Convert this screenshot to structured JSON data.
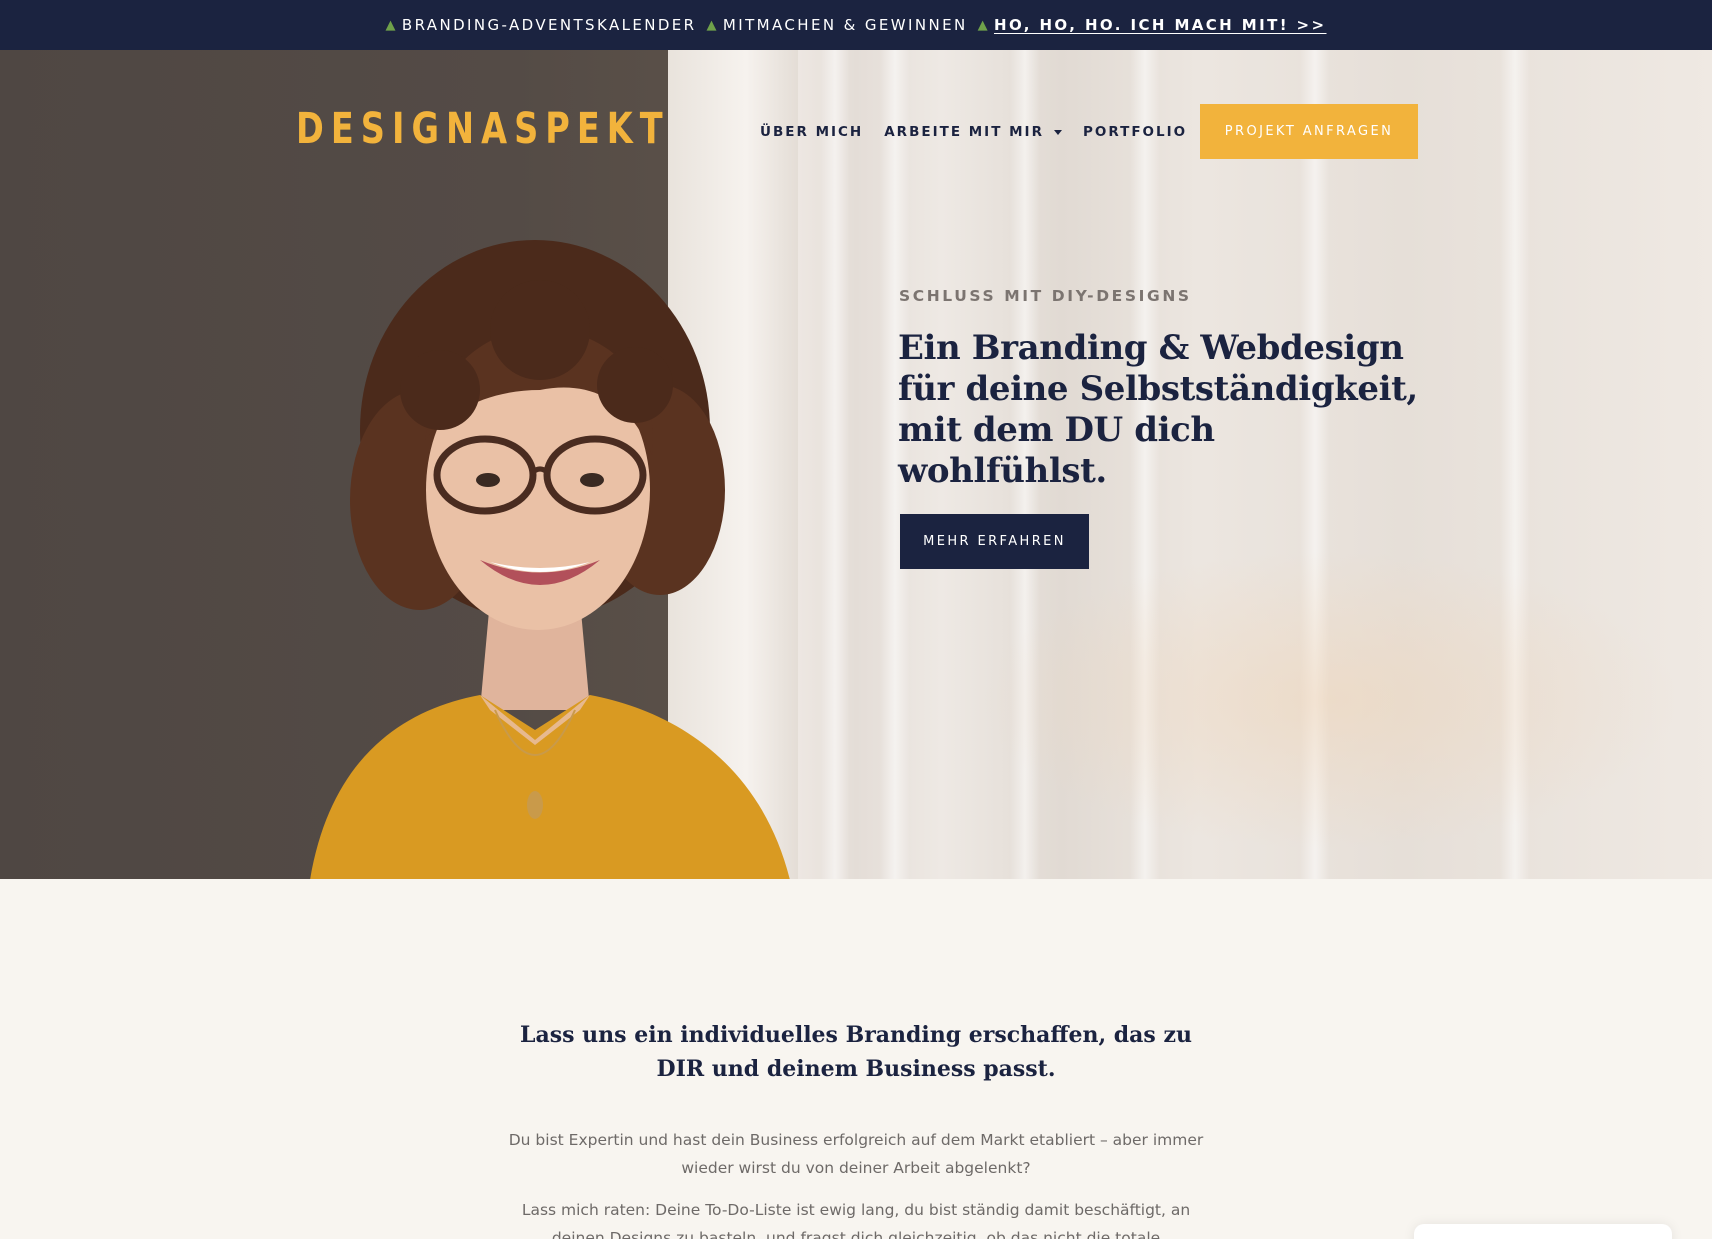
{
  "announcement": {
    "segment1": "BRANDING-ADVENTSKALENDER",
    "segment2": "MITMACHEN & GEWINNEN",
    "link_label": "HO, HO, HO. ICH MACH MIT! >>",
    "tree_icon": "tree-icon"
  },
  "header": {
    "logo": "DESIGNASPEKT",
    "nav": [
      {
        "label": "ÜBER MICH",
        "has_dropdown": false
      },
      {
        "label": "ARBEITE MIT MIR",
        "has_dropdown": true
      },
      {
        "label": "PORTFOLIO",
        "has_dropdown": false
      }
    ],
    "cta_label": "PROJEKT ANFRAGEN"
  },
  "hero": {
    "eyebrow": "SCHLUSS MIT DIY-DESIGNS",
    "headline": "Ein Branding & Webdesign für deine Selbstständigkeit, mit dem DU dich wohlfühlst.",
    "button_label": "MEHR ERFAHREN"
  },
  "intro": {
    "title": "Lass uns ein individuelles Branding erschaffen, das zu DIR und deinem Business passt.",
    "paragraph1": "Du bist Expertin und hast dein Business erfolgreich auf dem Markt etabliert – aber immer wieder wirst du von deiner Arbeit abgelenkt?",
    "paragraph2": "Lass mich raten: Deine To-Do-Liste ist ewig lang, du bist ständig damit beschäftigt, an deinen Designs zu basteln, und fragst dich gleichzeitig, ob das nicht die totale"
  },
  "colors": {
    "navy": "#1b2340",
    "mustard": "#f2b33c",
    "cream": "#f8f5f0",
    "muted_text": "#6e6a68"
  }
}
